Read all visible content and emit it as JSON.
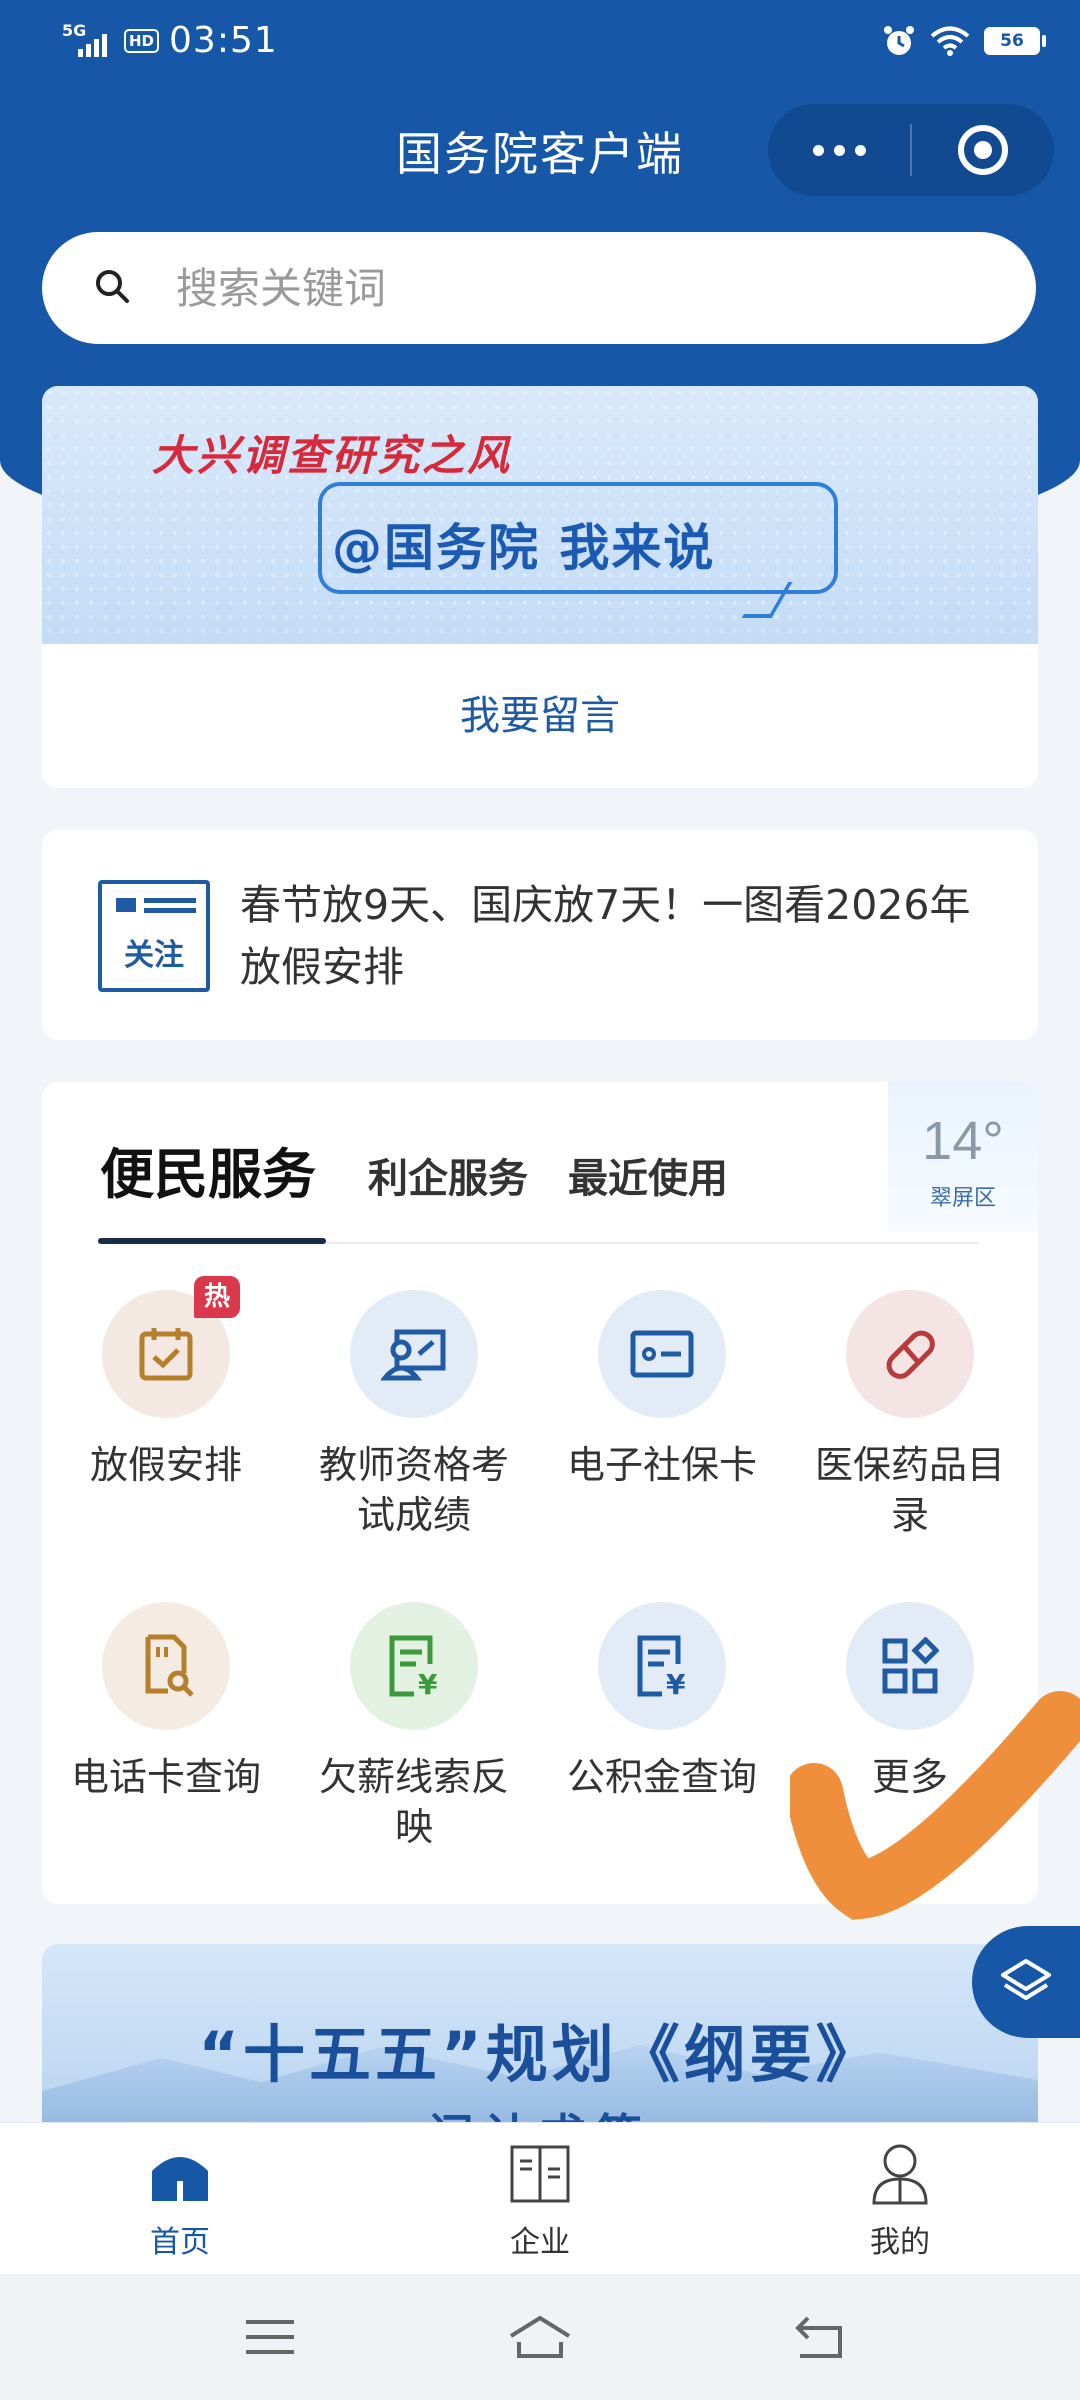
{
  "status_bar": {
    "network": "5G",
    "hd": "HD",
    "time": "03:51",
    "battery": "56"
  },
  "header": {
    "title": "国务院客户端"
  },
  "search": {
    "placeholder": "搜索关键词"
  },
  "banner": {
    "headline": "大兴调查研究之风",
    "subline": "@国务院  我来说",
    "action": "我要留言"
  },
  "notice": {
    "badge": "关注",
    "text": "春节放9天、国庆放7天！一图看2026年放假安排"
  },
  "services": {
    "tabs": [
      "便民服务",
      "利企服务",
      "最近使用"
    ],
    "weather": {
      "temp": "14°",
      "district": "翠屏区"
    },
    "hot_badge": "热",
    "items": [
      {
        "label": "放假安排",
        "icon": "calendar-check-icon"
      },
      {
        "label": "教师资格考试成绩",
        "icon": "teacher-board-icon"
      },
      {
        "label": "电子社保卡",
        "icon": "id-card-icon"
      },
      {
        "label": "医保药品目录",
        "icon": "pill-icon"
      },
      {
        "label": "电话卡查询",
        "icon": "sim-search-icon"
      },
      {
        "label": "欠薪线索反映",
        "icon": "wage-document-icon"
      },
      {
        "label": "公积金查询",
        "icon": "fund-document-icon"
      },
      {
        "label": "更多",
        "icon": "grid-more-icon"
      }
    ]
  },
  "promo": {
    "title": "“十五五”规划《纲要》",
    "subtitle": "问计求策"
  },
  "tabbar": {
    "items": [
      {
        "label": "首页",
        "icon": "home-icon"
      },
      {
        "label": "企业",
        "icon": "building-icon"
      },
      {
        "label": "我的",
        "icon": "user-icon"
      }
    ]
  },
  "colors": {
    "brand_blue": "#1757a8",
    "hot_red": "#d9394b"
  }
}
